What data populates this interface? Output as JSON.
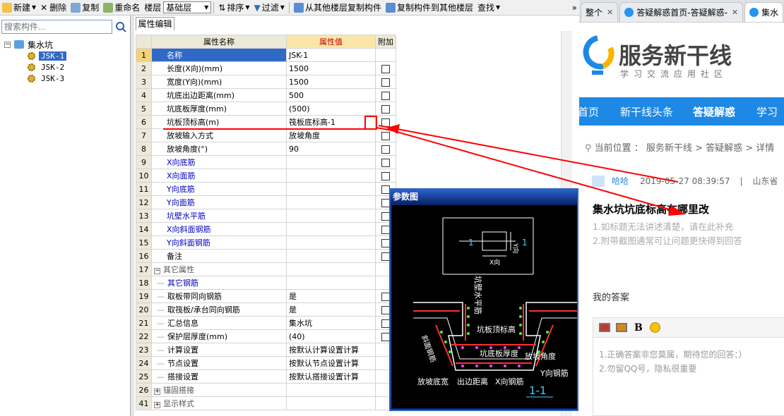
{
  "toolbar": {
    "new": "新建",
    "delete": "删除",
    "copy": "复制",
    "rename": "重命名",
    "floor_label": "楼层",
    "floor_value": "基础层",
    "sort": "排序",
    "filter": "过滤",
    "copy_from": "从其他楼层复制构件",
    "copy_to": "复制构件到其他楼层",
    "find": "查找"
  },
  "search": {
    "placeholder": "搜索构件..."
  },
  "tree": {
    "root": "集水坑",
    "items": [
      "JSK-1",
      "JSK-2",
      "JSK-3"
    ]
  },
  "panel": {
    "tab": "属性编辑"
  },
  "grid": {
    "headers": [
      "属性名称",
      "属性值",
      "附加"
    ],
    "rows": [
      {
        "n": "1",
        "name": "名称",
        "value": "JSK-1"
      },
      {
        "n": "2",
        "name": "长度(X向)(mm)",
        "value": "1500"
      },
      {
        "n": "3",
        "name": "宽度(Y向)(mm)",
        "value": "1500"
      },
      {
        "n": "4",
        "name": "坑底出边距离(mm)",
        "value": "500"
      },
      {
        "n": "5",
        "name": "坑底板厚度(mm)",
        "value": "(500)"
      },
      {
        "n": "6",
        "name": "坑板顶标高(m)",
        "value": "筏板底标高-1"
      },
      {
        "n": "7",
        "name": "放坡输入方式",
        "value": "放坡角度"
      },
      {
        "n": "8",
        "name": "放坡角度(°)",
        "value": "90"
      },
      {
        "n": "9",
        "name": "X向底筋",
        "value": ""
      },
      {
        "n": "10",
        "name": "X向面筋",
        "value": ""
      },
      {
        "n": "11",
        "name": "Y向底筋",
        "value": ""
      },
      {
        "n": "12",
        "name": "Y向面筋",
        "value": ""
      },
      {
        "n": "13",
        "name": "坑壁水平筋",
        "value": ""
      },
      {
        "n": "14",
        "name": "X向斜面钢筋",
        "value": ""
      },
      {
        "n": "15",
        "name": "Y向斜面钢筋",
        "value": ""
      },
      {
        "n": "16",
        "name": "备注",
        "value": ""
      },
      {
        "n": "17",
        "name": "其它属性",
        "value": ""
      },
      {
        "n": "18",
        "name": "其它钢筋",
        "value": ""
      },
      {
        "n": "19",
        "name": "取板带同向钢筋",
        "value": "是"
      },
      {
        "n": "20",
        "name": "取筏板/承台同向钢筋",
        "value": "是"
      },
      {
        "n": "21",
        "name": "汇总信息",
        "value": "集水坑"
      },
      {
        "n": "22",
        "name": "保护层厚度(mm)",
        "value": "(40)"
      },
      {
        "n": "23",
        "name": "计算设置",
        "value": "按默认计算设置计算"
      },
      {
        "n": "24",
        "name": "节点设置",
        "value": "按默认节点设置计算"
      },
      {
        "n": "25",
        "name": "搭接设置",
        "value": "按默认搭接设置计算"
      },
      {
        "n": "26",
        "name": "锚固搭接",
        "value": ""
      },
      {
        "n": "41",
        "name": "显示样式",
        "value": ""
      }
    ]
  },
  "diagram": {
    "title": "参数图",
    "labels": {
      "sec_a": "1",
      "sec_b": "1",
      "xdir": "X向",
      "ydir": "Y向",
      "wall_rebar": "坑壁水平筋",
      "top_elev": "坑板顶标高",
      "bottom_thk": "坑底板厚度",
      "slope_angle": "放坡角度",
      "y_rebar": "Y向钢筋",
      "slope_rebar": "斜面钢筋",
      "slope_width": "放坡底宽",
      "edge_dist": "出边距离",
      "x_rebar": "X向钢筋",
      "section": "1-1"
    }
  },
  "browser": {
    "tabs": [
      "整个",
      "答疑解惑首页-答疑解惑-",
      "集水"
    ],
    "logo_title": "服务新干线",
    "logo_sub": "学习交流应用社区",
    "nav": [
      "首页",
      "新干线头条",
      "答疑解惑",
      "学习"
    ],
    "crumb": "当前位置 ： 服务新干线 > 答疑解惑 > 详情",
    "user": "哈哈",
    "time": "2019-05-27 08:39:57",
    "sep": "|",
    "region": "山东省 ",
    "question": "集水坑坑底标高在哪里改",
    "hint1": "1.如标题无法讲述清楚，请在此补充",
    "hint2": "2.附带截图通常可让问题更快得到回答",
    "answer_label": "我的答案",
    "bold_btn": "B",
    "ph1": "1.正确答案非您莫属，期待您的回答：）",
    "ph2": "2.勿留QQ号，隐私很重要"
  },
  "colors": {
    "accent": "#1e88e5",
    "annotation": "#ff0000",
    "selection": "#3169c6"
  }
}
